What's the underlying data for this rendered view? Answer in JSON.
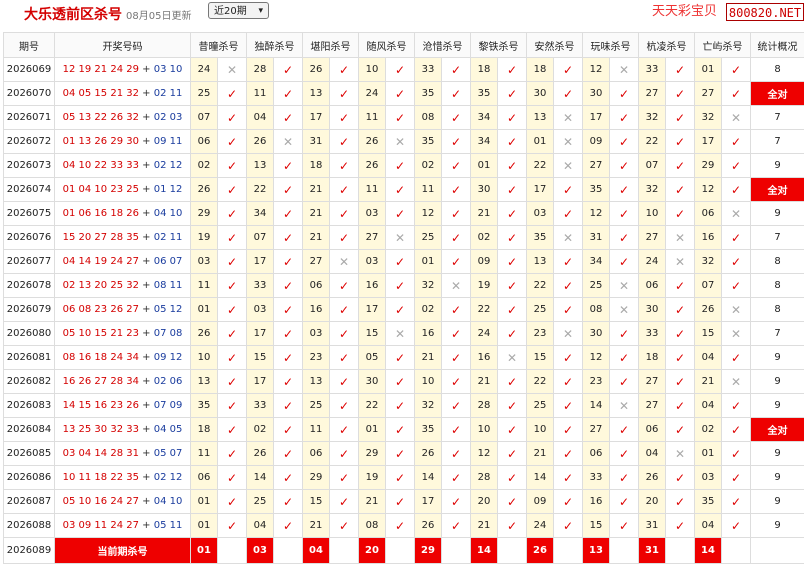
{
  "header": {
    "title": "大乐透前区杀号",
    "updated": "08月05日更新",
    "period_select": "近20期",
    "slogan": "天天彩宝贝",
    "site": "800820.NET"
  },
  "columns": {
    "period": "期号",
    "draw": "开奖号码",
    "summary": "统计概况",
    "experts": [
      "昔曈杀号",
      "独醉杀号",
      "堪阳杀号",
      "随风杀号",
      "沧惜杀号",
      "黎铁杀号",
      "安然杀号",
      "玩味杀号",
      "杭凌杀号",
      "亡屿杀号"
    ]
  },
  "rows": [
    {
      "period": "2026069",
      "front": "12 19 21 24 29",
      "back": "03 10",
      "kills": [
        [
          "24",
          0
        ],
        [
          "28",
          1
        ],
        [
          "26",
          1
        ],
        [
          "10",
          1
        ],
        [
          "33",
          1
        ],
        [
          "18",
          1
        ],
        [
          "18",
          1
        ],
        [
          "12",
          0
        ],
        [
          "33",
          1
        ],
        [
          "01",
          1
        ]
      ],
      "summary": "8",
      "all": false
    },
    {
      "period": "2026070",
      "front": "04 05 15 21 32",
      "back": "02 11",
      "kills": [
        [
          "25",
          1
        ],
        [
          "11",
          1
        ],
        [
          "13",
          1
        ],
        [
          "24",
          1
        ],
        [
          "35",
          1
        ],
        [
          "35",
          1
        ],
        [
          "30",
          1
        ],
        [
          "30",
          1
        ],
        [
          "27",
          1
        ],
        [
          "27",
          1
        ]
      ],
      "summary": "全对",
      "all": true
    },
    {
      "period": "2026071",
      "front": "05 13 22 26 32",
      "back": "02 03",
      "kills": [
        [
          "07",
          1
        ],
        [
          "04",
          1
        ],
        [
          "17",
          1
        ],
        [
          "11",
          1
        ],
        [
          "08",
          1
        ],
        [
          "34",
          1
        ],
        [
          "13",
          0
        ],
        [
          "17",
          1
        ],
        [
          "32",
          1
        ],
        [
          "32",
          0
        ]
      ],
      "summary": "7",
      "all": false
    },
    {
      "period": "2026072",
      "front": "01 13 26 29 30",
      "back": "09 11",
      "kills": [
        [
          "06",
          1
        ],
        [
          "26",
          0
        ],
        [
          "31",
          1
        ],
        [
          "26",
          0
        ],
        [
          "35",
          1
        ],
        [
          "34",
          1
        ],
        [
          "01",
          0
        ],
        [
          "09",
          1
        ],
        [
          "22",
          1
        ],
        [
          "17",
          1
        ]
      ],
      "summary": "7",
      "all": false
    },
    {
      "period": "2026073",
      "front": "04 10 22 33 33",
      "back": "02 12",
      "kills": [
        [
          "02",
          1
        ],
        [
          "13",
          1
        ],
        [
          "18",
          1
        ],
        [
          "26",
          1
        ],
        [
          "02",
          1
        ],
        [
          "01",
          1
        ],
        [
          "22",
          0
        ],
        [
          "27",
          1
        ],
        [
          "07",
          1
        ],
        [
          "29",
          1
        ]
      ],
      "summary": "9",
      "all": false
    },
    {
      "period": "2026074",
      "front": "01 04 10 23 25",
      "back": "01 12",
      "kills": [
        [
          "26",
          1
        ],
        [
          "22",
          1
        ],
        [
          "21",
          1
        ],
        [
          "11",
          1
        ],
        [
          "11",
          1
        ],
        [
          "30",
          1
        ],
        [
          "17",
          1
        ],
        [
          "35",
          1
        ],
        [
          "32",
          1
        ],
        [
          "12",
          1
        ]
      ],
      "summary": "全对",
      "all": true
    },
    {
      "period": "2026075",
      "front": "01 06 16 18 26",
      "back": "04 10",
      "kills": [
        [
          "29",
          1
        ],
        [
          "34",
          1
        ],
        [
          "21",
          1
        ],
        [
          "03",
          1
        ],
        [
          "12",
          1
        ],
        [
          "21",
          1
        ],
        [
          "03",
          1
        ],
        [
          "12",
          1
        ],
        [
          "10",
          1
        ],
        [
          "06",
          0
        ]
      ],
      "summary": "9",
      "all": false
    },
    {
      "period": "2026076",
      "front": "15 20 27 28 35",
      "back": "02 11",
      "kills": [
        [
          "19",
          1
        ],
        [
          "07",
          1
        ],
        [
          "21",
          1
        ],
        [
          "27",
          0
        ],
        [
          "25",
          1
        ],
        [
          "02",
          1
        ],
        [
          "35",
          0
        ],
        [
          "31",
          1
        ],
        [
          "27",
          0
        ],
        [
          "16",
          1
        ]
      ],
      "summary": "7",
      "all": false
    },
    {
      "period": "2026077",
      "front": "04 14 19 24 27",
      "back": "06 07",
      "kills": [
        [
          "03",
          1
        ],
        [
          "17",
          1
        ],
        [
          "27",
          0
        ],
        [
          "03",
          1
        ],
        [
          "01",
          1
        ],
        [
          "09",
          1
        ],
        [
          "13",
          1
        ],
        [
          "34",
          1
        ],
        [
          "24",
          0
        ],
        [
          "32",
          1
        ]
      ],
      "summary": "8",
      "all": false
    },
    {
      "period": "2026078",
      "front": "02 13 20 25 32",
      "back": "08 11",
      "kills": [
        [
          "11",
          1
        ],
        [
          "33",
          1
        ],
        [
          "06",
          1
        ],
        [
          "16",
          1
        ],
        [
          "32",
          0
        ],
        [
          "19",
          1
        ],
        [
          "22",
          1
        ],
        [
          "25",
          0
        ],
        [
          "06",
          1
        ],
        [
          "07",
          1
        ]
      ],
      "summary": "8",
      "all": false
    },
    {
      "period": "2026079",
      "front": "06 08 23 26 27",
      "back": "05 12",
      "kills": [
        [
          "01",
          1
        ],
        [
          "03",
          1
        ],
        [
          "16",
          1
        ],
        [
          "17",
          1
        ],
        [
          "02",
          1
        ],
        [
          "22",
          1
        ],
        [
          "25",
          1
        ],
        [
          "08",
          0
        ],
        [
          "30",
          1
        ],
        [
          "26",
          0
        ]
      ],
      "summary": "8",
      "all": false
    },
    {
      "period": "2026080",
      "front": "05 10 15 21 23",
      "back": "07 08",
      "kills": [
        [
          "26",
          1
        ],
        [
          "17",
          1
        ],
        [
          "03",
          1
        ],
        [
          "15",
          0
        ],
        [
          "16",
          1
        ],
        [
          "24",
          1
        ],
        [
          "23",
          0
        ],
        [
          "30",
          1
        ],
        [
          "33",
          1
        ],
        [
          "15",
          0
        ]
      ],
      "summary": "7",
      "all": false
    },
    {
      "period": "2026081",
      "front": "08 16 18 24 34",
      "back": "09 12",
      "kills": [
        [
          "10",
          1
        ],
        [
          "15",
          1
        ],
        [
          "23",
          1
        ],
        [
          "05",
          1
        ],
        [
          "21",
          1
        ],
        [
          "16",
          0
        ],
        [
          "15",
          1
        ],
        [
          "12",
          1
        ],
        [
          "18",
          1
        ],
        [
          "04",
          1
        ]
      ],
      "summary": "9",
      "all": false
    },
    {
      "period": "2026082",
      "front": "16 26 27 28 34",
      "back": "02 06",
      "kills": [
        [
          "13",
          1
        ],
        [
          "17",
          1
        ],
        [
          "13",
          1
        ],
        [
          "30",
          1
        ],
        [
          "10",
          1
        ],
        [
          "21",
          1
        ],
        [
          "22",
          1
        ],
        [
          "23",
          1
        ],
        [
          "27",
          1
        ],
        [
          "21",
          0
        ]
      ],
      "summary": "9",
      "all": false
    },
    {
      "period": "2026083",
      "front": "14 15 16 23 26",
      "back": "07 09",
      "kills": [
        [
          "35",
          1
        ],
        [
          "33",
          1
        ],
        [
          "25",
          1
        ],
        [
          "22",
          1
        ],
        [
          "32",
          1
        ],
        [
          "28",
          1
        ],
        [
          "25",
          1
        ],
        [
          "14",
          0
        ],
        [
          "27",
          1
        ],
        [
          "04",
          1
        ]
      ],
      "summary": "9",
      "all": false
    },
    {
      "period": "2026084",
      "front": "13 25 30 32 33",
      "back": "04 05",
      "kills": [
        [
          "18",
          1
        ],
        [
          "02",
          1
        ],
        [
          "11",
          1
        ],
        [
          "01",
          1
        ],
        [
          "35",
          1
        ],
        [
          "10",
          1
        ],
        [
          "10",
          1
        ],
        [
          "27",
          1
        ],
        [
          "06",
          1
        ],
        [
          "02",
          1
        ]
      ],
      "summary": "全对",
      "all": true
    },
    {
      "period": "2026085",
      "front": "03 04 14 28 31",
      "back": "05 07",
      "kills": [
        [
          "11",
          1
        ],
        [
          "26",
          1
        ],
        [
          "06",
          1
        ],
        [
          "29",
          1
        ],
        [
          "26",
          1
        ],
        [
          "12",
          1
        ],
        [
          "21",
          1
        ],
        [
          "06",
          1
        ],
        [
          "04",
          0
        ],
        [
          "01",
          1
        ]
      ],
      "summary": "9",
      "all": false
    },
    {
      "period": "2026086",
      "front": "10 11 18 22 35",
      "back": "02 12",
      "kills": [
        [
          "06",
          1
        ],
        [
          "14",
          1
        ],
        [
          "29",
          1
        ],
        [
          "19",
          1
        ],
        [
          "14",
          1
        ],
        [
          "28",
          1
        ],
        [
          "14",
          1
        ],
        [
          "33",
          1
        ],
        [
          "26",
          1
        ],
        [
          "03",
          1
        ]
      ],
      "summary": "9",
      "all": false
    },
    {
      "period": "2026087",
      "front": "05 10 16 24 27",
      "back": "04 10",
      "kills": [
        [
          "01",
          1
        ],
        [
          "25",
          1
        ],
        [
          "15",
          1
        ],
        [
          "21",
          1
        ],
        [
          "17",
          1
        ],
        [
          "20",
          1
        ],
        [
          "09",
          1
        ],
        [
          "16",
          1
        ],
        [
          "20",
          1
        ],
        [
          "35",
          1
        ]
      ],
      "summary": "9",
      "all": false
    },
    {
      "period": "2026088",
      "front": "03 09 11 24 27",
      "back": "05 11",
      "kills": [
        [
          "01",
          1
        ],
        [
          "04",
          1
        ],
        [
          "21",
          1
        ],
        [
          "08",
          1
        ],
        [
          "26",
          1
        ],
        [
          "21",
          1
        ],
        [
          "24",
          1
        ],
        [
          "15",
          1
        ],
        [
          "31",
          1
        ],
        [
          "04",
          1
        ]
      ],
      "summary": "9",
      "all": false
    }
  ],
  "current": {
    "period": "2026089",
    "label": "当前期杀号",
    "kills": [
      "01",
      "03",
      "04",
      "20",
      "29",
      "14",
      "26",
      "13",
      "31",
      "14"
    ]
  },
  "marks": {
    "ok": "✓",
    "bad": "✕"
  }
}
